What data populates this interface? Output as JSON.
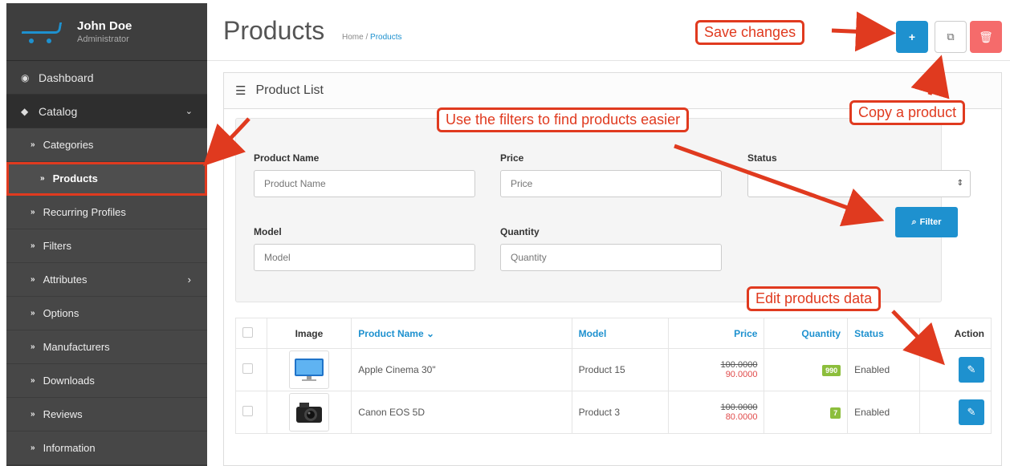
{
  "profile": {
    "name": "John Doe",
    "role": "Administrator"
  },
  "nav": {
    "dashboard": "Dashboard",
    "catalog": "Catalog",
    "sub": [
      {
        "label": "Categories",
        "active": false
      },
      {
        "label": "Products",
        "active": true
      },
      {
        "label": "Recurring Profiles",
        "active": false
      },
      {
        "label": "Filters",
        "active": false
      },
      {
        "label": "Attributes",
        "active": false,
        "has_children": true
      },
      {
        "label": "Options",
        "active": false
      },
      {
        "label": "Manufacturers",
        "active": false
      },
      {
        "label": "Downloads",
        "active": false
      },
      {
        "label": "Reviews",
        "active": false
      },
      {
        "label": "Information",
        "active": false
      }
    ]
  },
  "header": {
    "title": "Products",
    "breadcrumb": {
      "home": "Home",
      "separator": "/",
      "current": "Products"
    },
    "buttons": {
      "add": "+",
      "copy": "⧉",
      "delete": "🗑"
    }
  },
  "panel": {
    "title": "Product List"
  },
  "filters": {
    "product_name": {
      "label": "Product Name",
      "placeholder": "Product Name"
    },
    "price": {
      "label": "Price",
      "placeholder": "Price"
    },
    "status": {
      "label": "Status",
      "value": ""
    },
    "model": {
      "label": "Model",
      "placeholder": "Model"
    },
    "quantity": {
      "label": "Quantity",
      "placeholder": "Quantity"
    },
    "filter_button": "Filter"
  },
  "table": {
    "columns": {
      "image": "Image",
      "product_name": "Product Name",
      "model": "Model",
      "price": "Price",
      "quantity": "Quantity",
      "status": "Status",
      "action": "Action"
    },
    "rows": [
      {
        "name": "Apple Cinema 30\"",
        "model": "Product 15",
        "price_old": "100.0000",
        "price_new": "90.0000",
        "quantity": "990",
        "status": "Enabled",
        "image": "monitor"
      },
      {
        "name": "Canon EOS 5D",
        "model": "Product 3",
        "price_old": "100.0000",
        "price_new": "80.0000",
        "quantity": "7",
        "status": "Enabled",
        "image": "camera"
      }
    ]
  },
  "annotations": {
    "save": "Save changes",
    "copy": "Copy a product",
    "filters": "Use the filters to find products easier",
    "edit": "Edit products data"
  },
  "colors": {
    "accent": "#1e91cf",
    "annotation": "#e03a1f",
    "sidebar": "#3a3a3a",
    "danger": "#f56b6b",
    "quantity_badge": "#8cbe3c"
  }
}
